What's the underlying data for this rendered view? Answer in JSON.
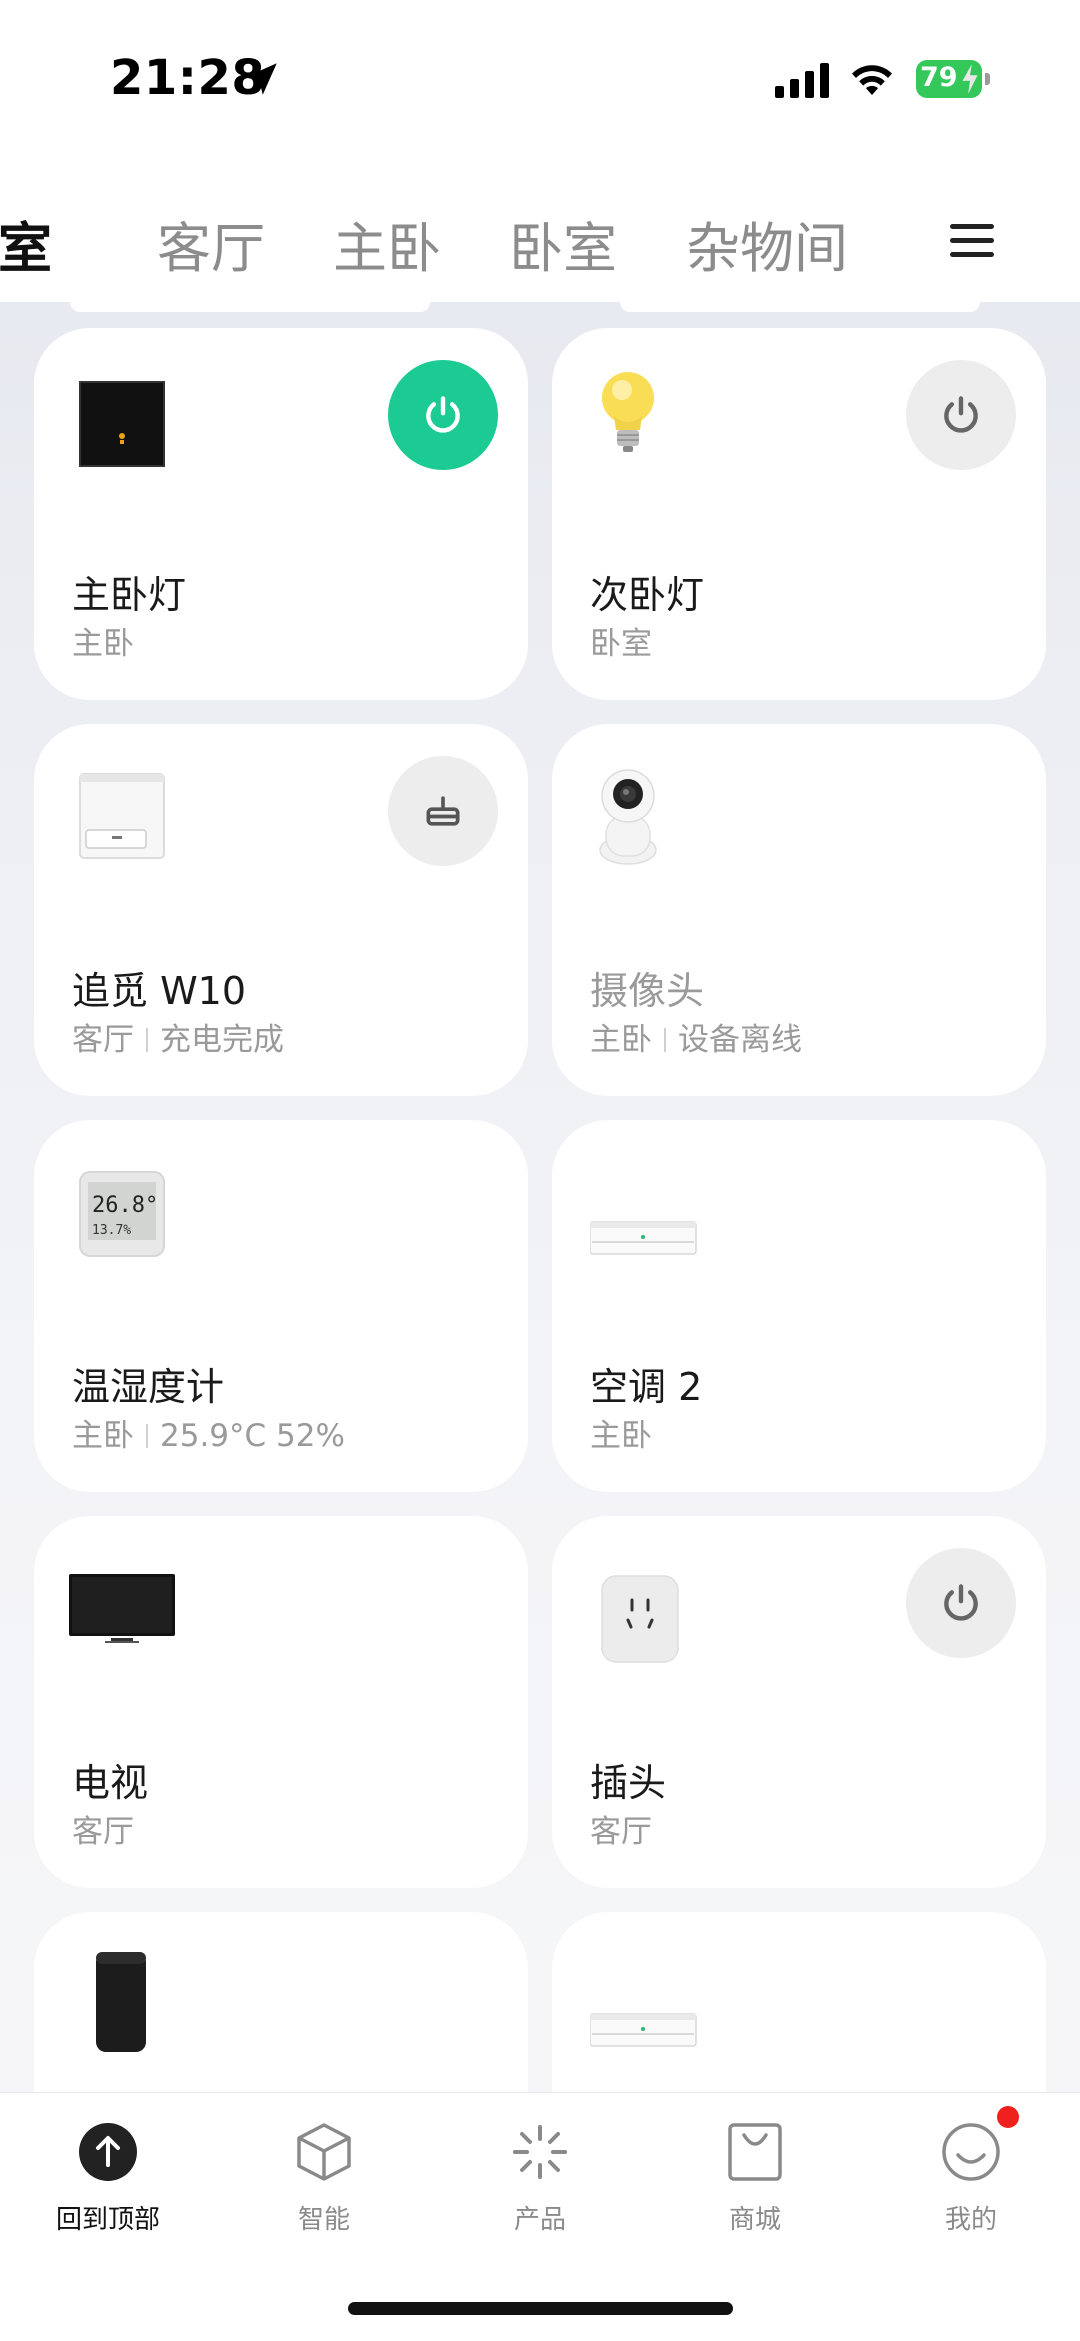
{
  "status_bar": {
    "time": "21:28",
    "battery_percent": "79",
    "battery_charging": true,
    "signal_bars": 4,
    "wifi": true
  },
  "rooms_tabs": {
    "items": [
      "卧室",
      "客厅",
      "主卧",
      "卧室",
      "杂物间"
    ],
    "active_index": 0
  },
  "devices": [
    {
      "name": "主卧灯",
      "room": "主卧",
      "status": "",
      "icon": "wall-switch-image",
      "action": "power",
      "action_on": true
    },
    {
      "name": "次卧灯",
      "room": "卧室",
      "status": "",
      "icon": "bulb-image",
      "action": "power",
      "action_on": false
    },
    {
      "name": "追觅 W10",
      "room": "客厅",
      "status": "充电完成",
      "icon": "robot-vacuum-station-image",
      "action": "dock",
      "action_on": false
    },
    {
      "name": "摄像头",
      "room": "主卧",
      "status": "设备离线",
      "icon": "camera-image",
      "action": "",
      "offline": true
    },
    {
      "name": "温湿度计",
      "room": "主卧",
      "status": "25.9°C 52%",
      "icon": "thermo-hygrometer-image",
      "action": ""
    },
    {
      "name": "空调 2",
      "room": "主卧",
      "status": "",
      "icon": "air-conditioner-image",
      "action": ""
    },
    {
      "name": "电视",
      "room": "客厅",
      "status": "",
      "icon": "tv-image",
      "action": ""
    },
    {
      "name": "插头",
      "room": "客厅",
      "status": "",
      "icon": "smart-plug-image",
      "action": "power",
      "action_on": false
    },
    {
      "name": "",
      "room": "",
      "status": "",
      "icon": "smart-speaker-image",
      "action": ""
    },
    {
      "name": "",
      "room": "",
      "status": "",
      "icon": "air-conditioner-image",
      "action": ""
    }
  ],
  "thermo_display": {
    "temp": "26.8°",
    "humidity": "13.7%"
  },
  "bottom_nav": [
    {
      "label": "回到顶部",
      "icon": "arrow-up-circle-icon",
      "active": true
    },
    {
      "label": "智能",
      "icon": "cube-icon",
      "active": false
    },
    {
      "label": "产品",
      "icon": "sparkle-icon",
      "active": false
    },
    {
      "label": "商城",
      "icon": "shopping-bag-icon",
      "active": false
    },
    {
      "label": "我的",
      "icon": "smiley-icon",
      "active": false,
      "badge": true
    }
  ],
  "colors": {
    "accent_on": "#1ccb93",
    "action_off": "#ededed",
    "badge": "#f0201f",
    "battery": "#34c759"
  }
}
